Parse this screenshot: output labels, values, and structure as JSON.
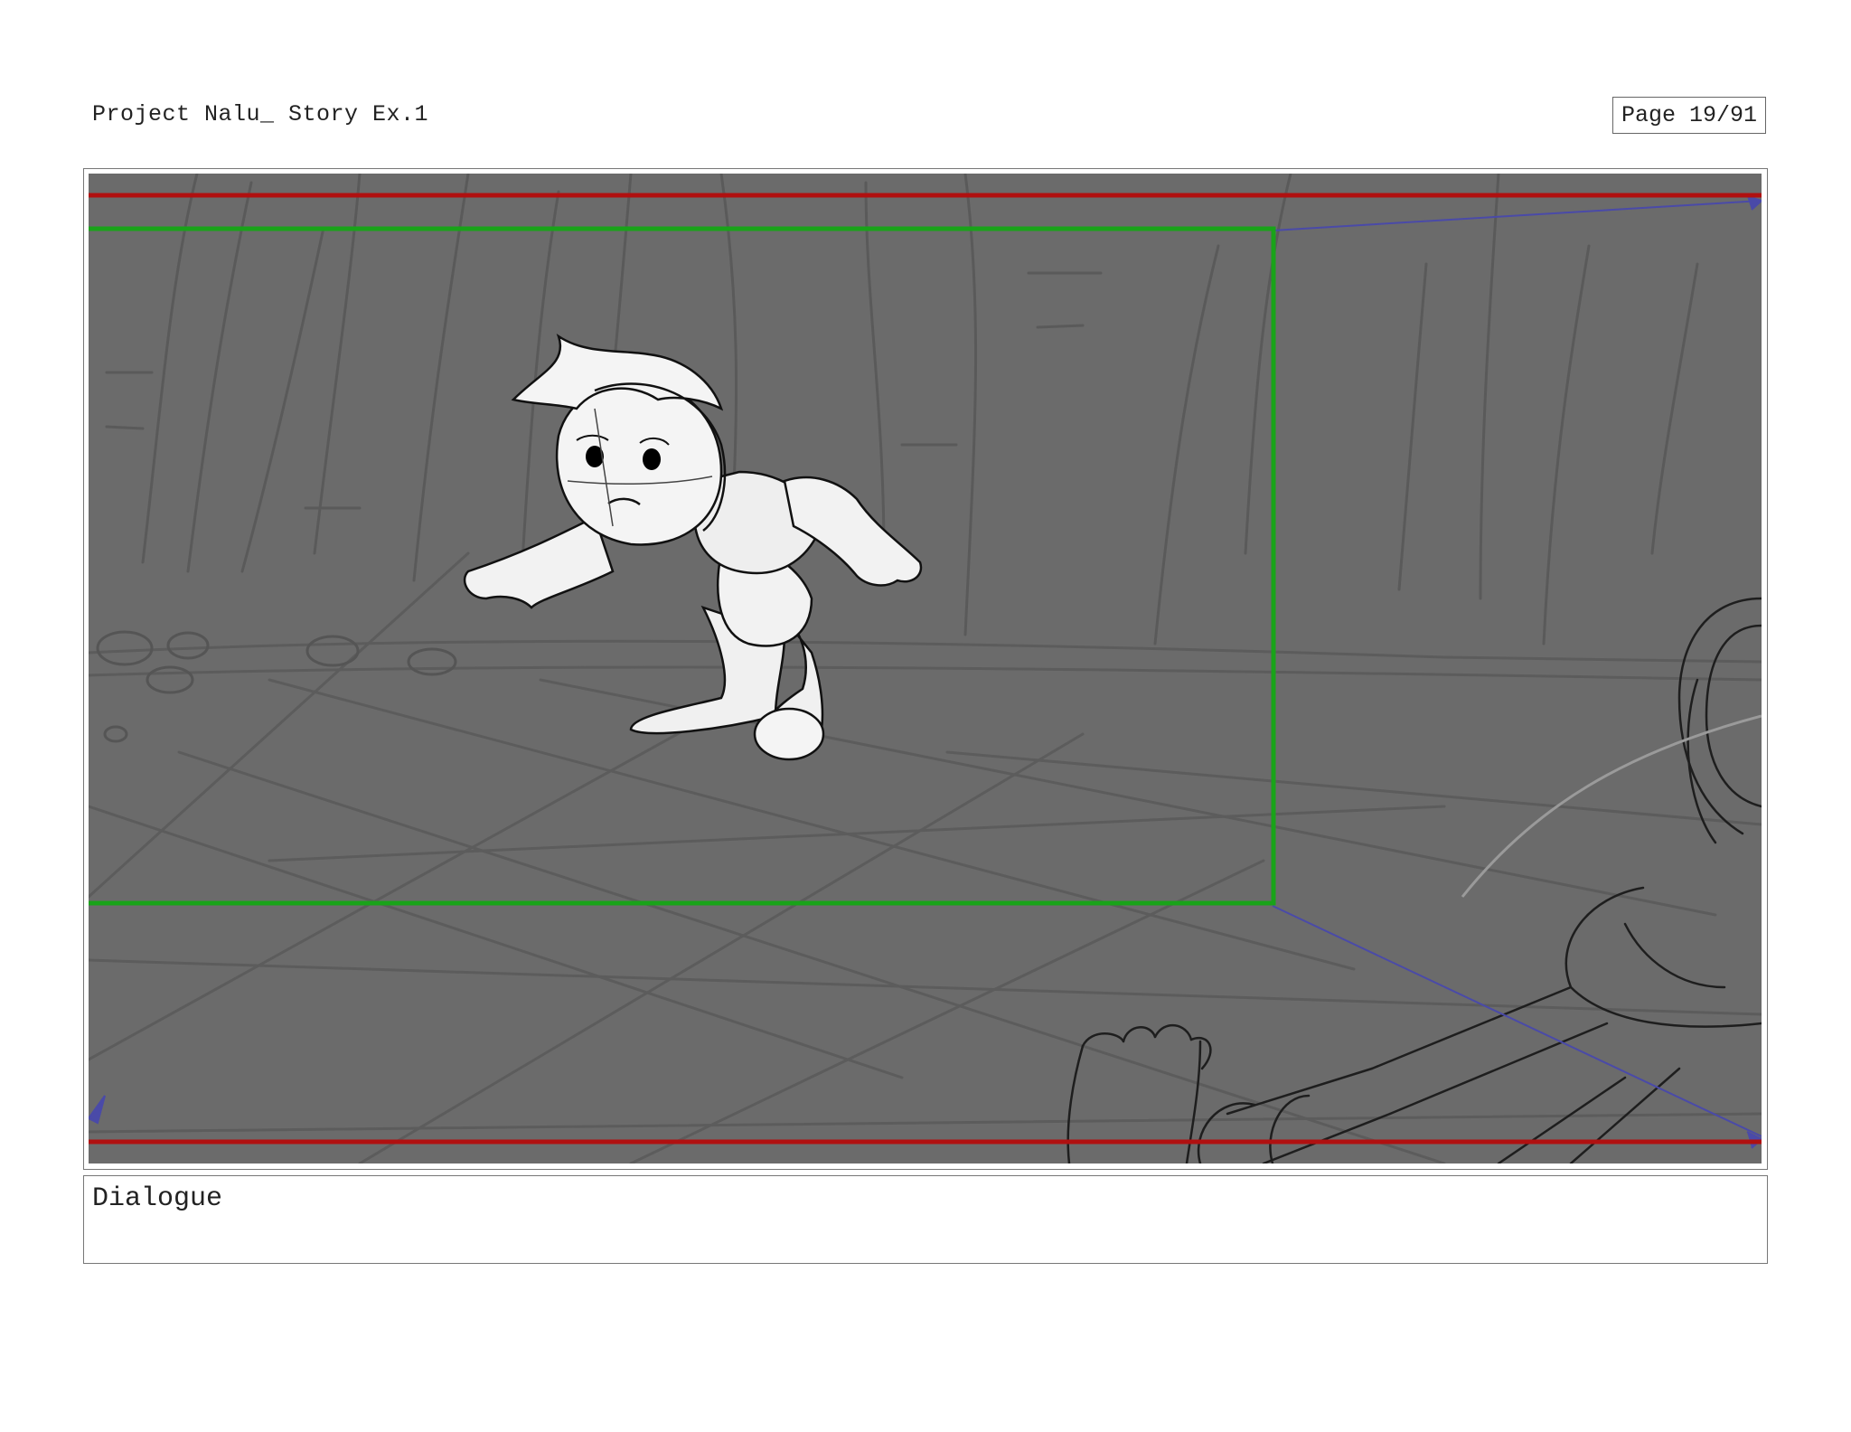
{
  "header": {
    "project_title": "Project Nalu_ Story Ex.1",
    "page_indicator": "Page 19/91"
  },
  "panel": {
    "safe_line_color": "#b01010",
    "camera_frame_color": "#19a319",
    "camera_move_color": "#4a4aa8",
    "background_color": "#6b6b6b"
  },
  "dialogue": {
    "label": "Dialogue",
    "text": ""
  }
}
